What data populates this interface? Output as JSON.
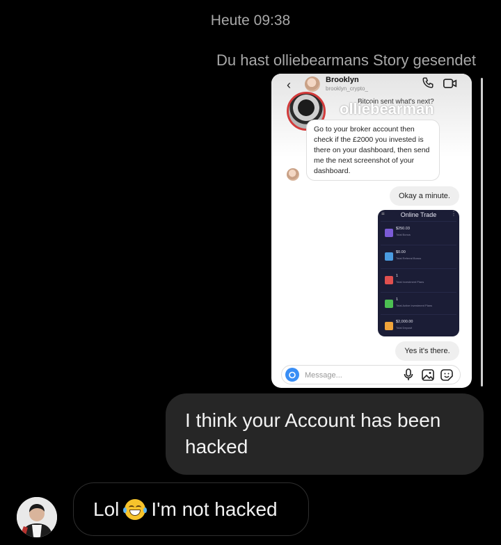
{
  "header": {
    "timestamp": "Heute 09:38"
  },
  "story_caption": "Du hast olliebearmans Story gesendet",
  "story": {
    "contact_name": "Brooklyn",
    "contact_username": "brooklyn_crypto_",
    "story_owner": "olliebearman",
    "faded_message": "Bitcoin sent what's next?",
    "incoming_message": "Go to your broker account then check if the £2000 you invested is there on your dashboard, then send me the next screenshot of your dashboard.",
    "outgoing_message_1": "Okay a minute.",
    "dashboard": {
      "title": "Online Trade",
      "rows": [
        {
          "value": "$250.03",
          "label": "Total Bonus",
          "color": "#7b5bd6"
        },
        {
          "value": "$0.00",
          "label": "Total Referral Bonus",
          "color": "#4a9be0"
        },
        {
          "value": "1",
          "label": "Total Investment Plans",
          "color": "#e0504f"
        },
        {
          "value": "1",
          "label": "Total Active Investment Plans",
          "color": "#4cbf52"
        },
        {
          "value": "$2,000.00",
          "label": "Total Deposit",
          "color": "#f0a43a"
        }
      ]
    },
    "outgoing_message_2": "Yes it's there.",
    "message_placeholder": "Message..."
  },
  "messages": {
    "sent": "I think your Account has been hacked",
    "reply_before_emoji": "Lol",
    "reply_emoji": "grinning-squinting-face-with-tears",
    "reply_after_emoji": "I'm not hacked"
  },
  "colors": {
    "background": "#000000",
    "sent_bubble": "#262626",
    "accent_blue": "#3a8ef5",
    "story_ring": "#d23b3b"
  }
}
